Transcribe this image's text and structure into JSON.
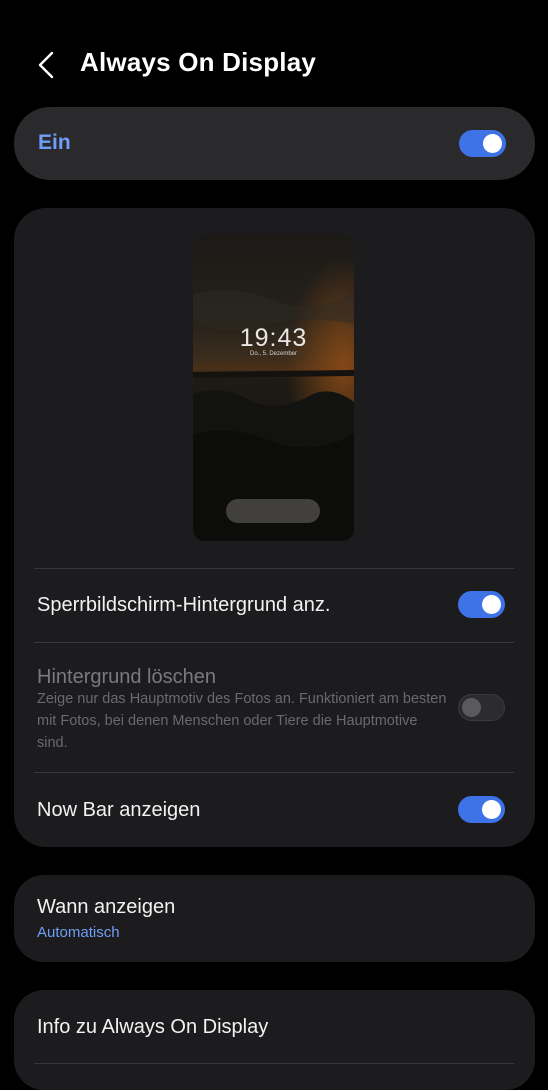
{
  "header": {
    "title": "Always On Display"
  },
  "master": {
    "label": "Ein",
    "on": true
  },
  "preview": {
    "time": "19:43",
    "date": "Do., 5. Dezember"
  },
  "settings": [
    {
      "label": "Sperrbildschirm-Hintergrund anz.",
      "on": true
    },
    {
      "label": "Hintergrund löschen",
      "description": "Zeige nur das Hauptmotiv des Fotos an. Funktioniert am besten mit Fotos, bei denen Menschen oder Tiere die Hauptmotive sind.",
      "on": false,
      "enabled": false
    },
    {
      "label": "Now Bar anzeigen",
      "on": true
    }
  ],
  "when": {
    "label": "Wann anzeigen",
    "value": "Automatisch"
  },
  "info": {
    "label": "Info zu Always On Display"
  },
  "colors": {
    "accent": "#3e73e8",
    "accent_text": "#6f9ef7",
    "card": "#1c1c1e",
    "background": "#000000"
  },
  "icons": {
    "back": "back-arrow-icon"
  }
}
